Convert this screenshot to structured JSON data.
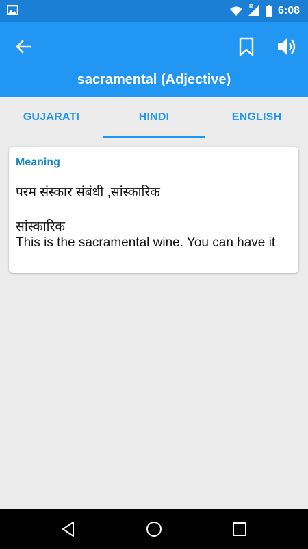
{
  "status_bar": {
    "time": "6:08",
    "network_badge": "R"
  },
  "app_bar": {
    "title": "sacramental (Adjective)",
    "icons": [
      "arrow-back-icon",
      "bookmark-icon",
      "volume-icon"
    ]
  },
  "tabs": [
    {
      "label": "GUJARATI",
      "active": false
    },
    {
      "label": "HINDI",
      "active": true
    },
    {
      "label": "ENGLISH",
      "active": false
    }
  ],
  "card": {
    "heading": "Meaning",
    "meaning": "परम संस्कार संबंधी ,सांस्कारिक",
    "word": "सांस्कारिक",
    "example": "This is the sacramental wine. You can have it"
  },
  "colors": {
    "primary": "#2196f3",
    "primary_dark": "#1b7fd6",
    "background": "#ececec",
    "heading": "#1e88c8"
  }
}
